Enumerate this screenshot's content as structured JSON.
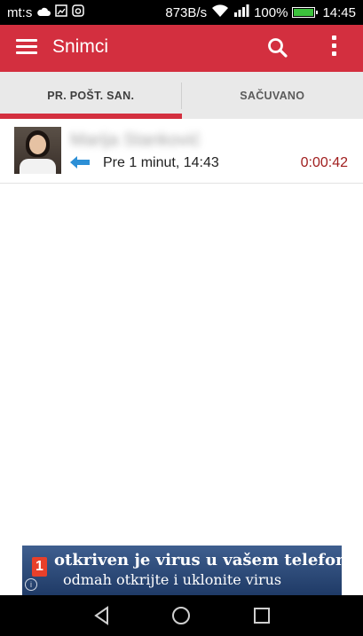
{
  "status_bar": {
    "carrier": "mt:s",
    "network_speed": "873B/s",
    "battery_percent": "100%",
    "battery_level": 1.0,
    "time": "14:45"
  },
  "toolbar": {
    "title": "Snimci",
    "menu_icon": "hamburger-menu-icon",
    "search_icon": "search-icon",
    "more_icon": "more-vertical-icon"
  },
  "tabs": [
    {
      "label": "PR. POŠT. SAN.",
      "active": true
    },
    {
      "label": "SAČUVANO",
      "active": false
    }
  ],
  "recordings": [
    {
      "contact_name": "Marija Stanković",
      "direction_icon": "incoming-arrow-icon",
      "time": "Pre 1 minut, 14:43",
      "duration": "0:00:42"
    }
  ],
  "ad": {
    "badge": "1",
    "line1": "otkriven je virus u vašem telefonu?",
    "line2": "odmah otkrijte i uklonite virus",
    "info_icon": "info-icon"
  },
  "navbar": {
    "back_icon": "back-triangle-icon",
    "home_icon": "home-circle-icon",
    "recents_icon": "recents-square-icon"
  },
  "colors": {
    "accent": "#d32f3f",
    "duration": "#a01e1e",
    "direction_arrow": "#2c8fd6"
  }
}
